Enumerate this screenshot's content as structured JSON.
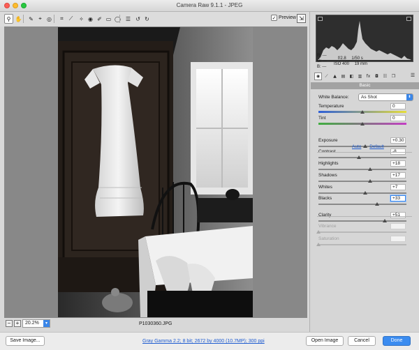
{
  "window": {
    "title": "Camera Raw 9.1.1  -  JPEG"
  },
  "toolbar": {
    "tools": [
      {
        "icon": "zoom-icon",
        "glyph": "⚲",
        "active": true
      },
      {
        "icon": "hand-icon",
        "glyph": "✋",
        "active": false
      },
      {
        "icon": "white-balance-icon",
        "glyph": "✎",
        "active": false
      },
      {
        "icon": "color-sampler-icon",
        "glyph": "⌖",
        "active": false
      },
      {
        "icon": "targeted-adjust-icon",
        "glyph": "◎",
        "active": false
      },
      {
        "icon": "crop-icon",
        "glyph": "⌗",
        "active": false
      },
      {
        "icon": "straighten-icon",
        "glyph": "⟋",
        "active": false
      },
      {
        "icon": "spot-removal-icon",
        "glyph": "✧",
        "active": false
      },
      {
        "icon": "red-eye-icon",
        "glyph": "◉",
        "active": false
      },
      {
        "icon": "adjustment-brush-icon",
        "glyph": "✐",
        "active": false
      },
      {
        "icon": "graduated-filter-icon",
        "glyph": "▭",
        "active": false
      },
      {
        "icon": "radial-filter-icon",
        "glyph": "◯",
        "active": false
      },
      {
        "icon": "preferences-icon",
        "glyph": "☰",
        "active": false
      },
      {
        "icon": "rotate-ccw-icon",
        "glyph": "↺",
        "active": false
      },
      {
        "icon": "rotate-cw-icon",
        "glyph": "↻",
        "active": false
      }
    ],
    "preview_label": "Preview",
    "preview_checked": true
  },
  "image": {
    "filename": "P1030360.JPG"
  },
  "status": {
    "zoom": "20.2%"
  },
  "bottom": {
    "save_label": "Save Image...",
    "workflow_link": "Gray Gamma 2.2; 8 bit; 2672 by 4000 (10.7MP); 300 ppi",
    "open_label": "Open Image",
    "cancel_label": "Cancel",
    "done_label": "Done"
  },
  "readout": {
    "r": "R:",
    "g": "G:",
    "b": "B:",
    "dash": "---",
    "aperture": "f/2.8",
    "shutter": "1/50 s",
    "iso": "ISO 400",
    "focal": "19 mm"
  },
  "panel": {
    "tabs": [
      {
        "icon": "basic-tab-icon",
        "glyph": "◉"
      },
      {
        "icon": "tone-curve-tab-icon",
        "glyph": "⟋"
      },
      {
        "icon": "detail-tab-icon",
        "glyph": "▲"
      },
      {
        "icon": "hsl-tab-icon",
        "glyph": "▤"
      },
      {
        "icon": "split-toning-tab-icon",
        "glyph": "◧"
      },
      {
        "icon": "lens-tab-icon",
        "glyph": "▥"
      },
      {
        "icon": "fx-tab-icon",
        "glyph": "fx"
      },
      {
        "icon": "camera-calibration-tab-icon",
        "glyph": "◘"
      },
      {
        "icon": "presets-tab-icon",
        "glyph": "☷"
      },
      {
        "icon": "snapshots-tab-icon",
        "glyph": "❐"
      }
    ],
    "section_title": "Basic",
    "white_balance_label": "White Balance:",
    "white_balance_value": "As Shot",
    "auto_label": "Auto",
    "default_label": "Default",
    "sliders": [
      {
        "label": "Temperature",
        "value": "0",
        "pos": 0.5,
        "track": "temp",
        "disabled": false,
        "focus": false
      },
      {
        "label": "Tint",
        "value": "0",
        "pos": 0.5,
        "track": "tint",
        "disabled": false,
        "focus": false
      },
      {
        "label": "Exposure",
        "value": "+0.30",
        "pos": 0.53,
        "track": "",
        "disabled": false,
        "focus": false
      },
      {
        "label": "Contrast",
        "value": "-8",
        "pos": 0.46,
        "track": "",
        "disabled": false,
        "focus": false
      },
      {
        "label": "Highlights",
        "value": "+18",
        "pos": 0.59,
        "track": "",
        "disabled": false,
        "focus": false
      },
      {
        "label": "Shadows",
        "value": "+17",
        "pos": 0.585,
        "track": "",
        "disabled": false,
        "focus": false
      },
      {
        "label": "Whites",
        "value": "+7",
        "pos": 0.535,
        "track": "",
        "disabled": false,
        "focus": false
      },
      {
        "label": "Blacks",
        "value": "+33",
        "pos": 0.665,
        "track": "",
        "disabled": false,
        "focus": true
      },
      {
        "label": "Clarity",
        "value": "+51",
        "pos": 0.755,
        "track": "",
        "disabled": false,
        "focus": false
      },
      {
        "label": "Vibrance",
        "value": "",
        "pos": 0.0,
        "track": "disabled",
        "disabled": true,
        "focus": false
      },
      {
        "label": "Saturation",
        "value": "",
        "pos": 0.0,
        "track": "disabled",
        "disabled": true,
        "focus": false
      }
    ]
  },
  "colors": {
    "accent": "#3b8cf0",
    "panel": "#d6d6d6",
    "canvas": "#888888"
  }
}
